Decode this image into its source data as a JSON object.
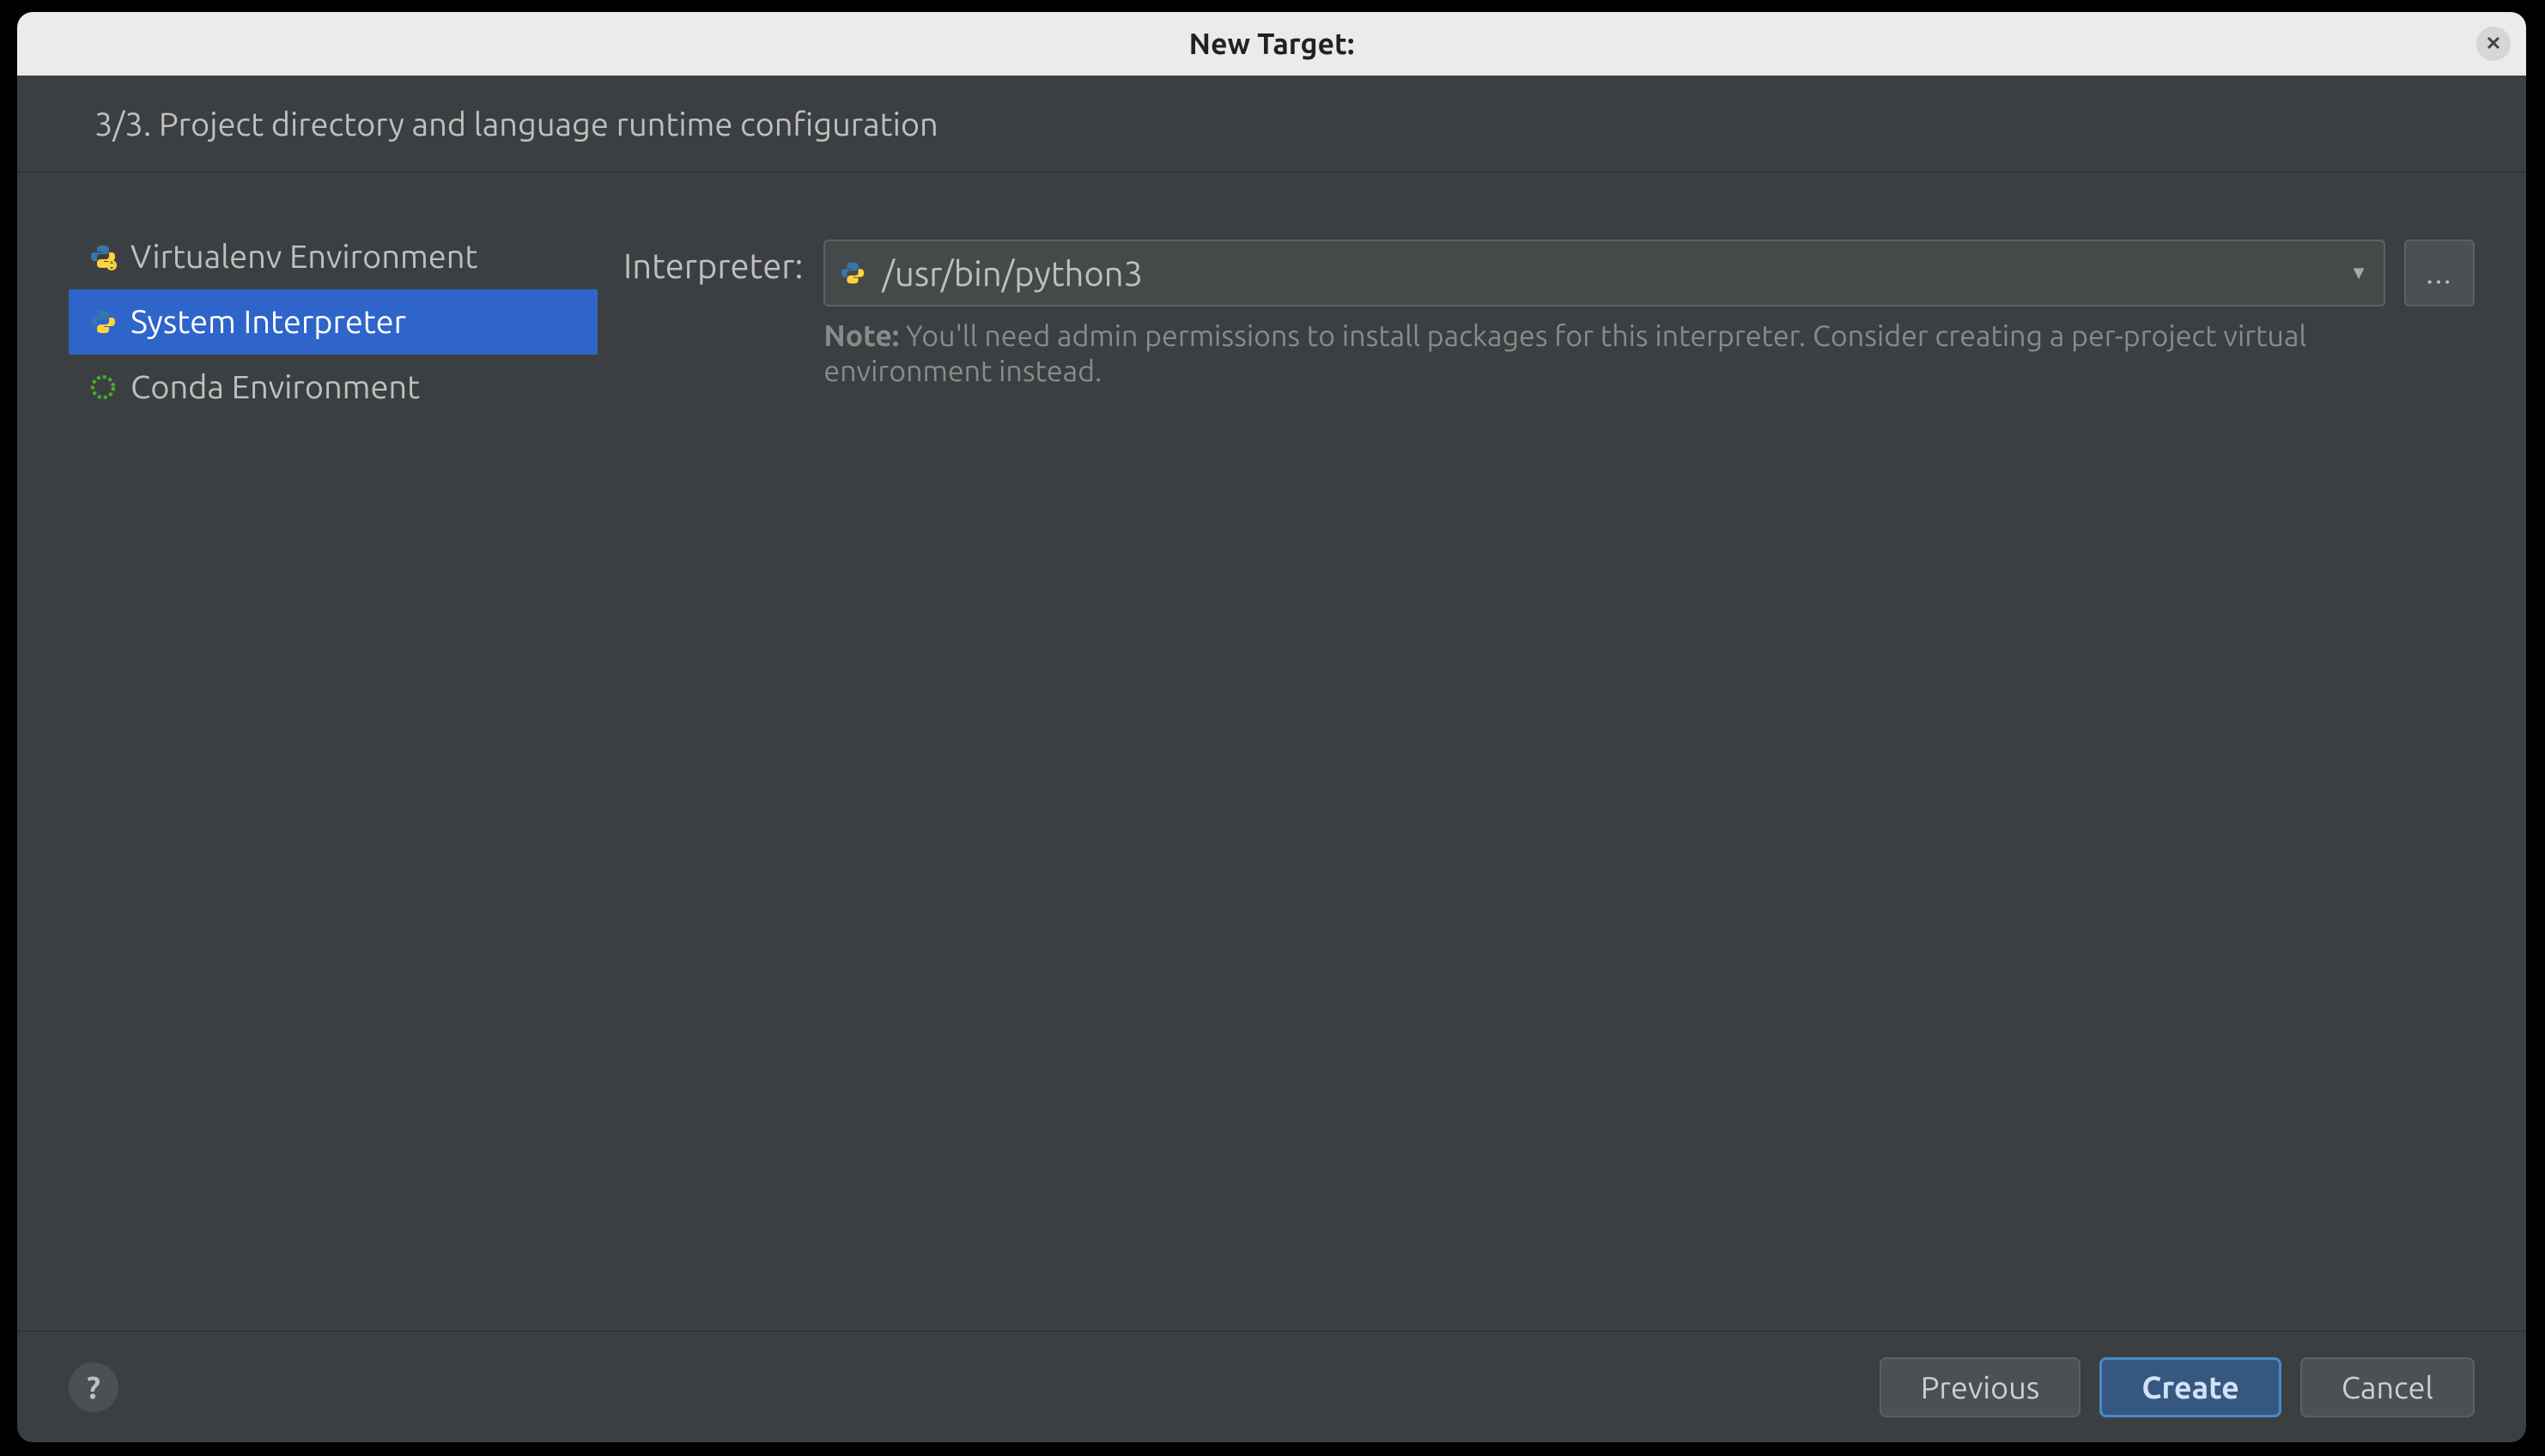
{
  "titlebar": {
    "title": "New Target:"
  },
  "header": {
    "step_title": "3/3. Project directory and language runtime configuration"
  },
  "sidebar": {
    "items": [
      {
        "label": "Virtualenv Environment",
        "icon": "python-venv",
        "selected": false
      },
      {
        "label": "System Interpreter",
        "icon": "python",
        "selected": true
      },
      {
        "label": "Conda Environment",
        "icon": "conda",
        "selected": false
      }
    ]
  },
  "form": {
    "interpreter_label": "Interpreter:",
    "interpreter_value": "/usr/bin/python3",
    "note_bold": "Note:",
    "note_text": " You'll need admin permissions to install packages for this interpreter. Consider creating a per-project virtual environment instead."
  },
  "footer": {
    "previous": "Previous",
    "create": "Create",
    "cancel": "Cancel"
  }
}
